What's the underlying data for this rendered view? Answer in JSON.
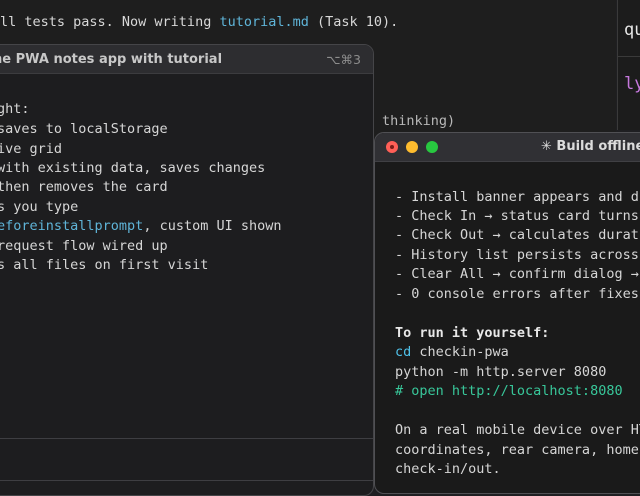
{
  "background_terminal": {
    "line1_prefix": "ll tests pass. Now writing ",
    "line1_file": "tutorial.md",
    "line1_suffix": " (Task 10).",
    "thinking": "thinking)"
  },
  "edge_window": {
    "top_text": "qu",
    "bottom_text": "ly"
  },
  "left_window": {
    "title": "ne PWA notes app with tutorial",
    "shortcut": "⌥⌘3",
    "lines": [
      {
        "text": "ght:"
      },
      {
        "text": " saves to localStorage"
      },
      {
        "text": "ive grid"
      },
      {
        "text": "with existing data, saves changes"
      },
      {
        "text": "then removes the card"
      },
      {
        "text": "s you type"
      },
      {
        "prefix": "",
        "accent": "eforeinstallprompt",
        "suffix": ", custom UI shown"
      },
      {
        "text": " request flow wired up"
      },
      {
        "text": "s all files on first visit"
      }
    ]
  },
  "right_window": {
    "title": "✳ Build offline",
    "lines": [
      {
        "text": "- Install banner appears and di"
      },
      {
        "text": "- Check In → status card turns"
      },
      {
        "text": "- Check Out → calculates durati"
      },
      {
        "text": "- History list persists across"
      },
      {
        "text": "- Clear All → confirm dialog →"
      },
      {
        "text": "- 0 console errors after fixes"
      },
      {
        "text": "To run it yourself:"
      },
      {
        "cmd": "cd",
        "arg": " checkin-pwa"
      },
      {
        "text": "python -m http.server 8080"
      },
      {
        "text": "# open http://localhost:8080"
      },
      {
        "text": "On a real mobile device over HT"
      },
      {
        "text": "coordinates, rear camera, home"
      },
      {
        "text": "check-in/out."
      }
    ]
  },
  "colors": {
    "accent": "#5fb4d8",
    "comment": "#38c79a",
    "traffic_close": "#ff5f57",
    "traffic_min": "#febc2e",
    "traffic_max": "#28c840"
  }
}
